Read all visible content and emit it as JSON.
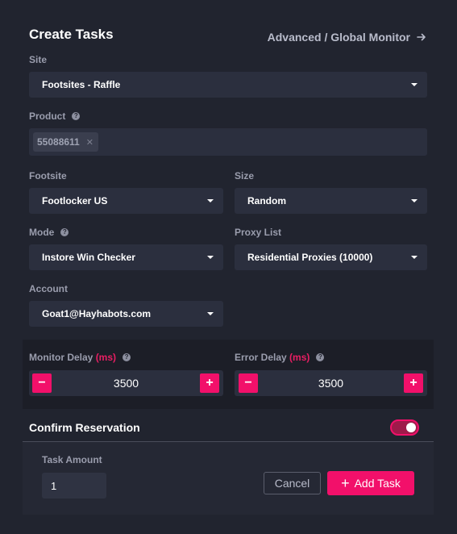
{
  "header": {
    "title": "Create Tasks",
    "advanced_link": "Advanced / Global Monitor"
  },
  "fields": {
    "site": {
      "label": "Site",
      "value": "Footsites - Raffle"
    },
    "product": {
      "label": "Product",
      "tags": [
        "55088611"
      ]
    },
    "footsite": {
      "label": "Footsite",
      "value": "Footlocker US"
    },
    "size": {
      "label": "Size",
      "value": "Random"
    },
    "mode": {
      "label": "Mode",
      "value": "Instore Win Checker"
    },
    "proxy_list": {
      "label": "Proxy List",
      "value": "Residential Proxies (10000)"
    },
    "account": {
      "label": "Account",
      "value": "Goat1@Hayhabots.com"
    }
  },
  "delays": {
    "unit": "(ms)",
    "monitor": {
      "label": "Monitor Delay",
      "value": "3500"
    },
    "error": {
      "label": "Error Delay",
      "value": "3500"
    }
  },
  "confirm_reservation": {
    "label": "Confirm Reservation",
    "enabled": true
  },
  "footer": {
    "task_amount_label": "Task Amount",
    "task_amount_value": "1",
    "cancel_label": "Cancel",
    "add_task_label": "Add Task"
  },
  "icons": {
    "help": "help-circle-icon",
    "arrow": "arrow-right-icon",
    "caret": "caret-down-icon",
    "minus": "minus-icon",
    "plus": "plus-icon",
    "tag_remove": "close-icon"
  },
  "colors": {
    "accent": "#f2106a",
    "panel": "#21242f",
    "input": "#2b2f3e",
    "label": "#9a9dad"
  }
}
